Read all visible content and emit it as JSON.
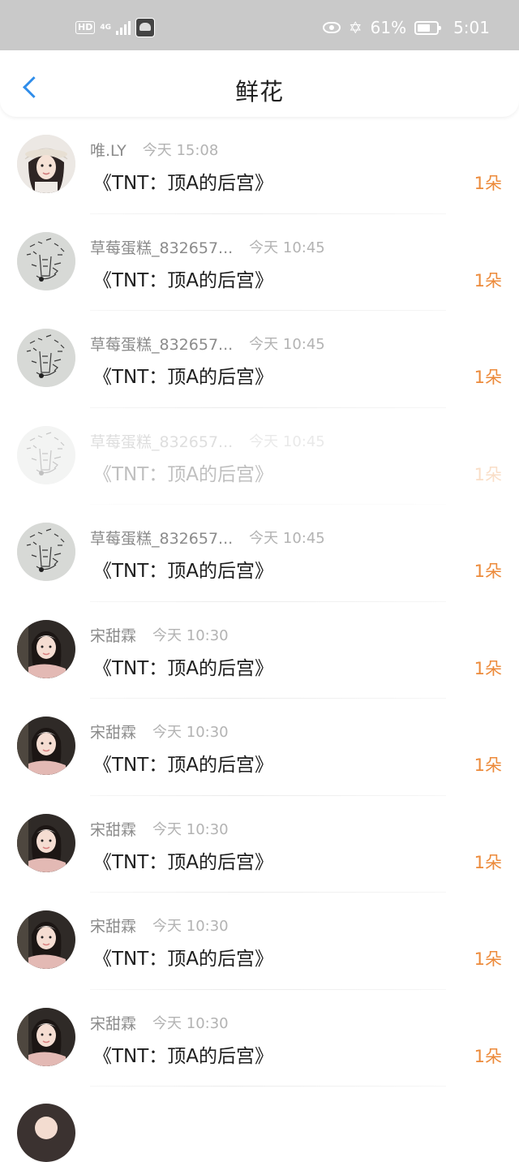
{
  "status_bar": {
    "hd_label": "HD",
    "network_label": "4G",
    "battery_percent": "61%",
    "time": "5:01"
  },
  "header": {
    "title": "鲜花",
    "back_icon": "chevron-left-icon"
  },
  "colors": {
    "accent": "#2f8dea",
    "count": "#ec8a3a",
    "status_bar_bg": "#c9c9c9"
  },
  "items": [
    {
      "user": "唯.LY",
      "time": "今天 15:08",
      "title": "《TNT：顶A的后宫》",
      "count": "1朵",
      "avatar": "girl-hat"
    },
    {
      "user": "草莓蛋糕_832657...",
      "time": "今天 10:45",
      "title": "《TNT：顶A的后宫》",
      "count": "1朵",
      "avatar": "sketch"
    },
    {
      "user": "草莓蛋糕_832657...",
      "time": "今天 10:45",
      "title": "《TNT：顶A的后宫》",
      "count": "1朵",
      "avatar": "sketch"
    },
    {
      "user": "草莓蛋糕_832657...",
      "time": "今天 10:45",
      "title": "《TNT：顶A的后宫》",
      "count": "1朵",
      "avatar": "sketch",
      "faded": true
    },
    {
      "user": "草莓蛋糕_832657...",
      "time": "今天 10:45",
      "title": "《TNT：顶A的后宫》",
      "count": "1朵",
      "avatar": "sketch"
    },
    {
      "user": "宋甜霖",
      "time": "今天 10:30",
      "title": "《TNT：顶A的后宫》",
      "count": "1朵",
      "avatar": "girl-dark"
    },
    {
      "user": "宋甜霖",
      "time": "今天 10:30",
      "title": "《TNT：顶A的后宫》",
      "count": "1朵",
      "avatar": "girl-dark"
    },
    {
      "user": "宋甜霖",
      "time": "今天 10:30",
      "title": "《TNT：顶A的后宫》",
      "count": "1朵",
      "avatar": "girl-dark"
    },
    {
      "user": "宋甜霖",
      "time": "今天 10:30",
      "title": "《TNT：顶A的后宫》",
      "count": "1朵",
      "avatar": "girl-dark"
    },
    {
      "user": "宋甜霖",
      "time": "今天 10:30",
      "title": "《TNT：顶A的后宫》",
      "count": "1朵",
      "avatar": "girl-dark"
    }
  ]
}
